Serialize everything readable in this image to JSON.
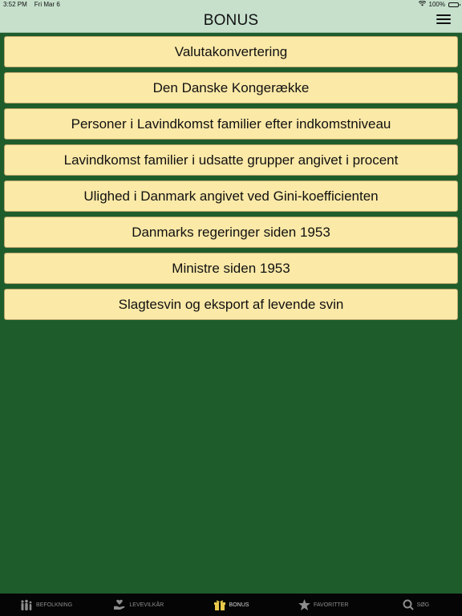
{
  "status_bar": {
    "time": "3:52 PM",
    "date": "Fri Mar 6",
    "battery": "100%"
  },
  "nav": {
    "title": "BONUS"
  },
  "items": [
    {
      "label": "Valutakonvertering"
    },
    {
      "label": "Den Danske Kongerække"
    },
    {
      "label": "Personer i Lavindkomst familier efter indkomstniveau"
    },
    {
      "label": "Lavindkomst familier i udsatte grupper angivet i procent"
    },
    {
      "label": "Ulighed i Danmark angivet ved Gini-koefficienten"
    },
    {
      "label": "Danmarks regeringer siden 1953"
    },
    {
      "label": "Ministre siden 1953"
    },
    {
      "label": "Slagtesvin og eksport af levende svin"
    }
  ],
  "tabs": [
    {
      "label": "BEFOLKNING",
      "icon": "people-icon"
    },
    {
      "label": "LEVEVILKÅR",
      "icon": "heart-hand-icon"
    },
    {
      "label": "BONUS",
      "icon": "gift-icon",
      "active": true
    },
    {
      "label": "FAVORITTER",
      "icon": "star-icon"
    },
    {
      "label": "SØG",
      "icon": "search-icon"
    }
  ],
  "colors": {
    "background": "#1e5c2c",
    "header": "#c6e0cc",
    "item": "#fbe9a7",
    "tab_bar": "#050505"
  }
}
